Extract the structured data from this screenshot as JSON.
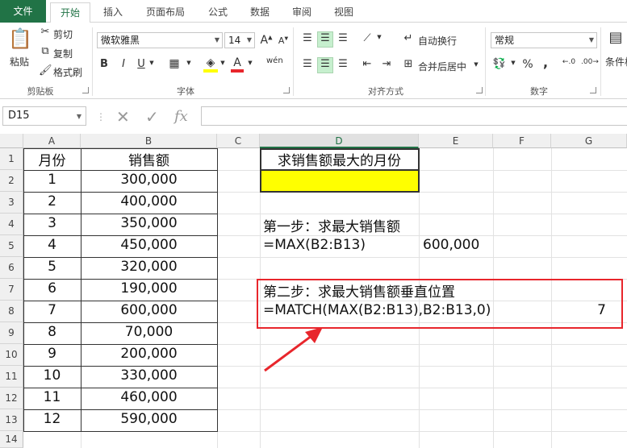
{
  "tabs": [
    "文件",
    "开始",
    "插入",
    "页面布局",
    "公式",
    "数据",
    "审阅",
    "视图"
  ],
  "clipboard": {
    "paste": "粘贴",
    "cut": "剪切",
    "copy": "复制",
    "painter": "格式刷",
    "label": "剪贴板"
  },
  "font": {
    "name": "微软雅黑",
    "size": "14",
    "bold": "B",
    "italic": "I",
    "underline": "U",
    "wen": "wén",
    "label": "字体"
  },
  "alignment": {
    "wrap": "自动换行",
    "merge": "合并后居中",
    "label": "对齐方式"
  },
  "number": {
    "format": "常规",
    "label": "数字",
    "percent": "%",
    "comma": ","
  },
  "styles": {
    "conditional": "条件格"
  },
  "formula_bar": {
    "name_box": "D15",
    "fx": "fx"
  },
  "columns": [
    "A",
    "B",
    "C",
    "D",
    "E",
    "F",
    "G"
  ],
  "rows": [
    "1",
    "2",
    "3",
    "4",
    "5",
    "6",
    "7",
    "8",
    "9",
    "10",
    "11",
    "12",
    "13",
    "14"
  ],
  "table": {
    "header_month": "月份",
    "header_sales": "销售额",
    "months": [
      "1",
      "2",
      "3",
      "4",
      "5",
      "6",
      "7",
      "8",
      "9",
      "10",
      "11",
      "12"
    ],
    "sales": [
      "300,000",
      "400,000",
      "350,000",
      "450,000",
      "320,000",
      "190,000",
      "600,000",
      "70,000",
      "200,000",
      "330,000",
      "460,000",
      "590,000"
    ]
  },
  "task": {
    "title": "求销售额最大的月份",
    "step1": "第一步：求最大销售额",
    "step1_formula": "=MAX(B2:B13)",
    "step1_result": "600,000",
    "step2": "第二步：求最大销售额垂直位置",
    "step2_formula": "=MATCH(MAX(B2:B13),B2:B13,0)",
    "step2_result": "7"
  },
  "colors": {
    "excel_green": "#217346",
    "highlight": "#ffff00",
    "annotation": "#e8262c"
  }
}
